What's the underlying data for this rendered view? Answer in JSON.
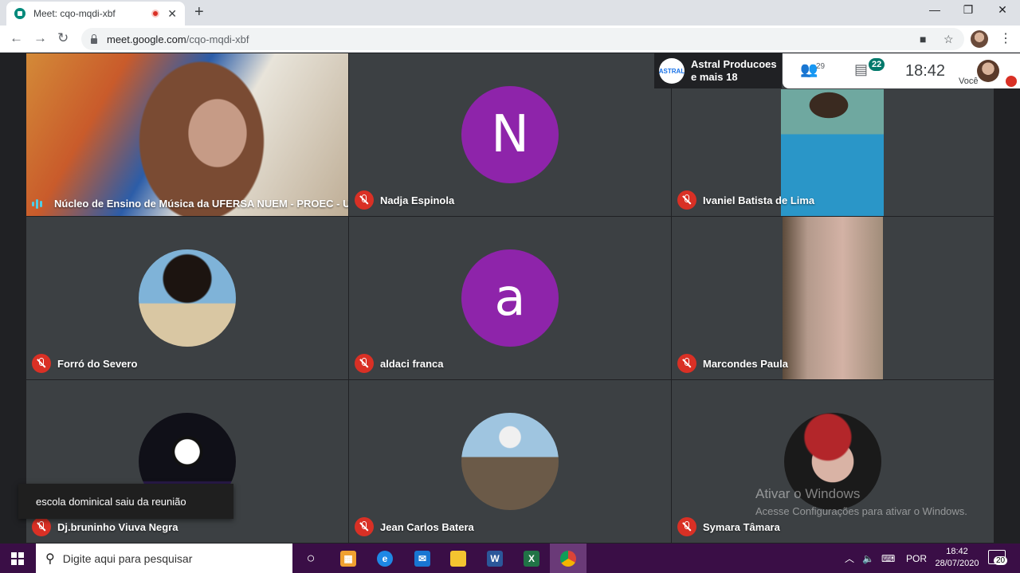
{
  "browser": {
    "tab_title": "Meet: cqo-mqdi-xbf",
    "url_host": "meet.google.com",
    "url_path": "/cqo-mqdi-xbf"
  },
  "meet": {
    "presenter": {
      "logo_text": "ASTRAL",
      "line1": "Astral Producoes",
      "line2": "e mais 18"
    },
    "people_count": "29",
    "chat_count": "22",
    "clock": "18:42",
    "self_label": "Você",
    "tiles": [
      {
        "name": "Núcleo de Ensino de Música da UFERSA NUEM - PROEC - UF...",
        "status": "speaking"
      },
      {
        "name": "Nadja Espinola",
        "initial": "N",
        "status": "muted"
      },
      {
        "name": "Ivaniel Batista de Lima",
        "status": "muted"
      },
      {
        "name": "Forró do Severo",
        "status": "muted"
      },
      {
        "name": "aldaci franca",
        "initial": "a",
        "status": "muted"
      },
      {
        "name": "Marcondes Paula",
        "status": "muted"
      },
      {
        "name": "Dj.bruninho Viuva Negra",
        "status": "muted"
      },
      {
        "name": "Jean Carlos Batera",
        "status": "muted"
      },
      {
        "name": "Symara Tâmara",
        "status": "muted"
      }
    ],
    "toast": "escola dominical saiu da reunião",
    "watermark": {
      "title": "Ativar o Windows",
      "subtitle": "Acesse Configurações para ativar o Windows."
    }
  },
  "taskbar": {
    "search_placeholder": "Digite aqui para pesquisar",
    "lang": "POR",
    "time": "18:42",
    "date": "28/07/2020",
    "notifications": "20"
  }
}
